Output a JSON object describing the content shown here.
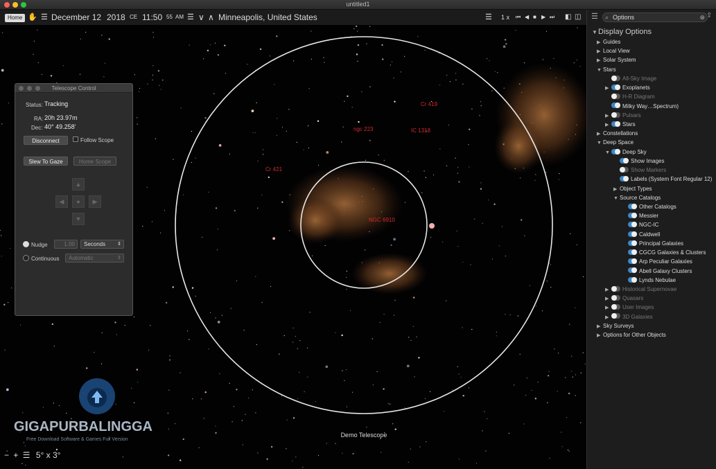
{
  "window": {
    "title": "untitled1"
  },
  "toolbar": {
    "home_label": "Home",
    "date": "December 12",
    "year": "2018",
    "era": "CE",
    "time": "11:50",
    "seconds": "55",
    "ampm": "AM",
    "location": "Minneapolis, United States",
    "rate": "1 x"
  },
  "sky": {
    "labels": {
      "cr419": "Cr 419",
      "ngc223": "ngc 223",
      "ic1318": "IC 1318",
      "cr421": "Cr 421",
      "ngc6910": "NGC 6910"
    },
    "scope_label": "Demo Telescope",
    "fov": "5° x 3°"
  },
  "telescope": {
    "title": "Telescope Control",
    "status_label": "Status:",
    "status_value": "Tracking",
    "ra_label": "RA:",
    "ra_value": "20h 23.97m",
    "dec_label": "Dec:",
    "dec_value": "40° 49.258'",
    "disconnect_label": "Disconnect",
    "follow_scope_label": "Follow Scope",
    "slew_label": "Slew To Gaze",
    "home_scope_label": "Home Scope",
    "nudge_label": "Nudge",
    "nudge_value": "1.00",
    "nudge_unit": "Seconds",
    "continuous_label": "Continuous",
    "continuous_value": "Automatic"
  },
  "options": {
    "search_placeholder": "Options",
    "heading": "Display Options",
    "items": [
      {
        "label": "Guides",
        "indent": 0,
        "tri": "right",
        "toggle": "none",
        "dim": false
      },
      {
        "label": "Local View",
        "indent": 0,
        "tri": "right",
        "toggle": "none",
        "dim": false
      },
      {
        "label": "Solar System",
        "indent": 0,
        "tri": "right",
        "toggle": "none",
        "dim": false
      },
      {
        "label": "Stars",
        "indent": 0,
        "tri": "down",
        "toggle": "none",
        "dim": false
      },
      {
        "label": "All-Sky Image",
        "indent": 1,
        "tri": "none",
        "toggle": "off",
        "dim": true
      },
      {
        "label": "Exoplanets",
        "indent": 1,
        "tri": "right",
        "toggle": "on",
        "dim": false
      },
      {
        "label": "H-R Diagram",
        "indent": 1,
        "tri": "none",
        "toggle": "off",
        "dim": true
      },
      {
        "label": "Milky Way…Spectrum)",
        "indent": 1,
        "tri": "none",
        "toggle": "on",
        "dim": false
      },
      {
        "label": "Pulsars",
        "indent": 1,
        "tri": "right",
        "toggle": "off",
        "dim": true
      },
      {
        "label": "Stars",
        "indent": 1,
        "tri": "right",
        "toggle": "on",
        "dim": false
      },
      {
        "label": "Constellations",
        "indent": 0,
        "tri": "right",
        "toggle": "none",
        "dim": false
      },
      {
        "label": "Deep Space",
        "indent": 0,
        "tri": "down",
        "toggle": "none",
        "dim": false
      },
      {
        "label": "Deep Sky",
        "indent": 1,
        "tri": "down",
        "toggle": "on",
        "dim": false
      },
      {
        "label": "Show Images",
        "indent": 2,
        "tri": "none",
        "toggle": "on",
        "dim": false
      },
      {
        "label": "Show Markers",
        "indent": 2,
        "tri": "none",
        "toggle": "off",
        "dim": true
      },
      {
        "label": "Labels (System Font Regular 12)",
        "indent": 2,
        "tri": "none",
        "toggle": "on",
        "dim": false
      },
      {
        "label": "Object Types",
        "indent": 2,
        "tri": "right",
        "toggle": "none",
        "dim": false
      },
      {
        "label": "Source Catalogs",
        "indent": 2,
        "tri": "down",
        "toggle": "none",
        "dim": false
      },
      {
        "label": "Other Catalogs",
        "indent": 3,
        "tri": "none",
        "toggle": "on",
        "dim": false
      },
      {
        "label": "Messier",
        "indent": 3,
        "tri": "none",
        "toggle": "on",
        "dim": false
      },
      {
        "label": "NGC-IC",
        "indent": 3,
        "tri": "none",
        "toggle": "on",
        "dim": false
      },
      {
        "label": "Caldwell",
        "indent": 3,
        "tri": "none",
        "toggle": "on",
        "dim": false
      },
      {
        "label": "Principal Galaxies",
        "indent": 3,
        "tri": "none",
        "toggle": "on",
        "dim": false
      },
      {
        "label": "CGCG Galaxies & Clusters",
        "indent": 3,
        "tri": "none",
        "toggle": "on",
        "dim": false
      },
      {
        "label": "Arp Peculiar Galaxies",
        "indent": 3,
        "tri": "none",
        "toggle": "on",
        "dim": false
      },
      {
        "label": "Abell Galaxy Clusters",
        "indent": 3,
        "tri": "none",
        "toggle": "on",
        "dim": false
      },
      {
        "label": "Lynds Nebulae",
        "indent": 3,
        "tri": "none",
        "toggle": "on",
        "dim": false
      },
      {
        "label": "Historical Supernovae",
        "indent": 1,
        "tri": "right",
        "toggle": "off",
        "dim": true
      },
      {
        "label": "Quasars",
        "indent": 1,
        "tri": "right",
        "toggle": "off",
        "dim": true
      },
      {
        "label": "User Images",
        "indent": 1,
        "tri": "right",
        "toggle": "off",
        "dim": true
      },
      {
        "label": "3D Galaxies",
        "indent": 1,
        "tri": "right",
        "toggle": "off",
        "dim": true
      },
      {
        "label": "Sky Surveys",
        "indent": 0,
        "tri": "right",
        "toggle": "none",
        "dim": false
      },
      {
        "label": "Options for Other Objects",
        "indent": 0,
        "tri": "right",
        "toggle": "none",
        "dim": false
      }
    ]
  },
  "watermark": {
    "title": "GIGAPURBALINGGA",
    "subtitle": "Free Download Software & Games Full Version"
  },
  "colors": {
    "accent": "#3d86c6",
    "label_red": "#d12a2a",
    "circle": "#e8e8e8"
  }
}
